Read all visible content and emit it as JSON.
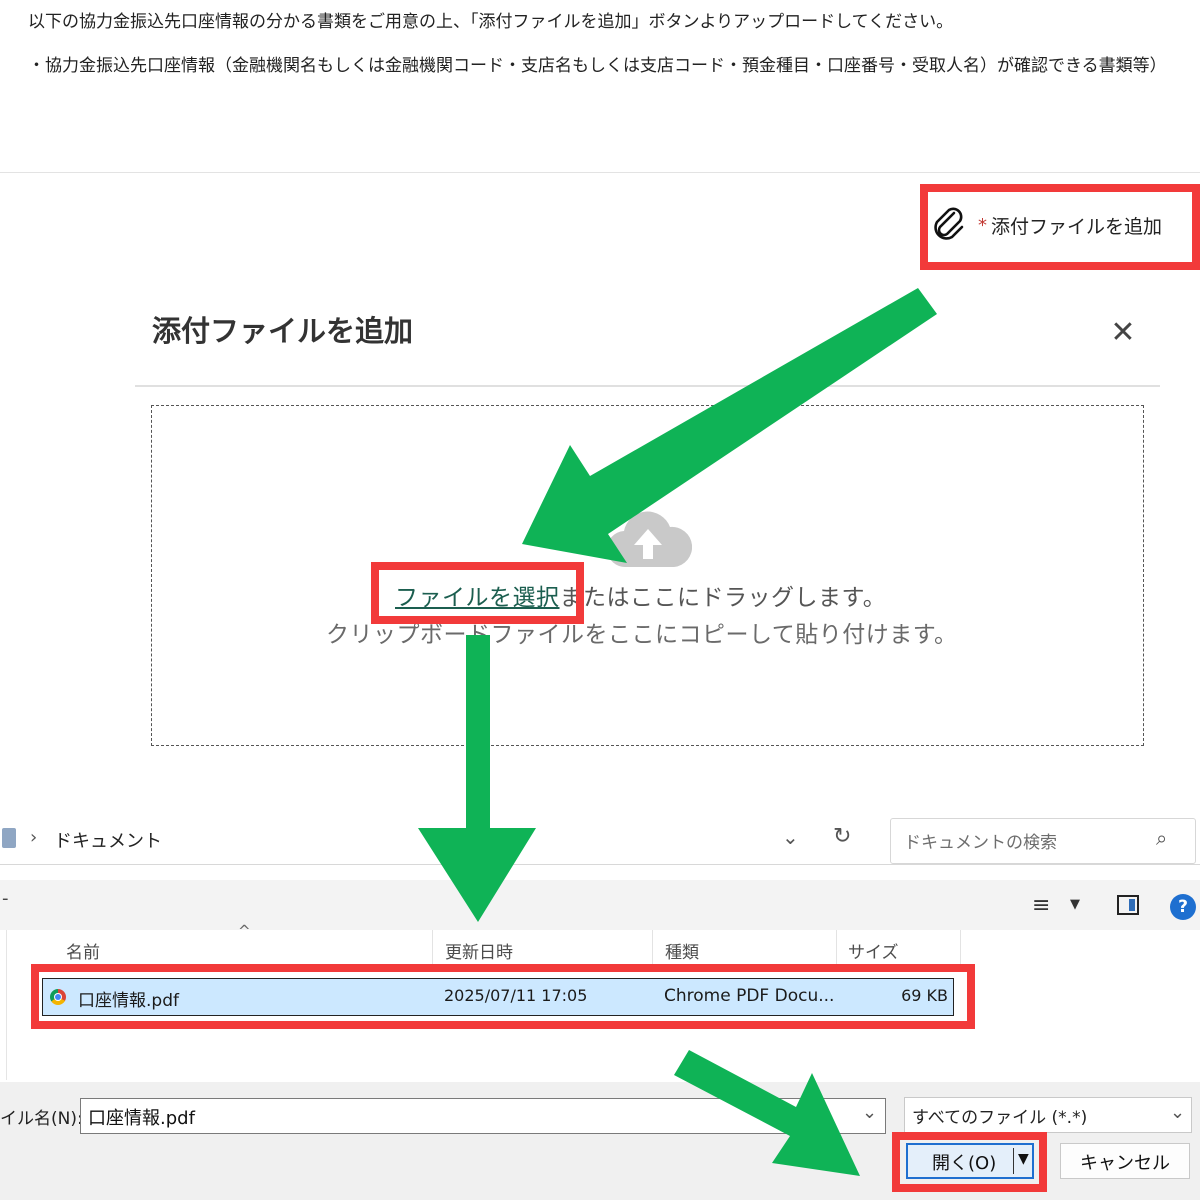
{
  "instructions": {
    "line1": "以下の協力金振込先口座情報の分かる書類をご用意の上、「添付ファイルを追加」ボタンよりアップロードしてください。",
    "line2": "・協力金振込先口座情報（金融機関名もしくは金融機関コード・支店名もしくは支店コード・預金種目・口座番号・受取人名）が確認できる書類等）"
  },
  "attach_button": {
    "required_mark": "*",
    "label": "添付ファイルを追加",
    "icon": "paperclip-icon"
  },
  "modal": {
    "title": "添付ファイルを追加",
    "close_icon": "✕",
    "drop_zone": {
      "icon": "cloud-upload-icon",
      "select_link": "ファイルを選択",
      "drag_text": "またはここにドラッグします。",
      "paste_text": "クリップボードファイルをここにコピーして貼り付けます。"
    }
  },
  "file_dialog": {
    "breadcrumb_sep": "›",
    "path": "ドキュメント",
    "search_placeholder": "ドキュメントの検索",
    "toolbar_label": "-",
    "help": "?",
    "columns": {
      "name": "名前",
      "modified": "更新日時",
      "type": "種類",
      "size": "サイズ"
    },
    "files": [
      {
        "name": "口座情報.pdf",
        "modified": "2025/07/11 17:05",
        "type": "Chrome PDF Docu...",
        "size": "69 KB"
      }
    ],
    "filename_label": "イル名(N):",
    "filename_value": "口座情報.pdf",
    "filter": "すべてのファイル (*.*)",
    "open_label": "開く(O)",
    "cancel_label": "キャンセル"
  },
  "colors": {
    "highlight": "#f23a3a",
    "arrow": "#0fb356",
    "selection": "#cce8ff",
    "link": "#1b5e4f"
  }
}
